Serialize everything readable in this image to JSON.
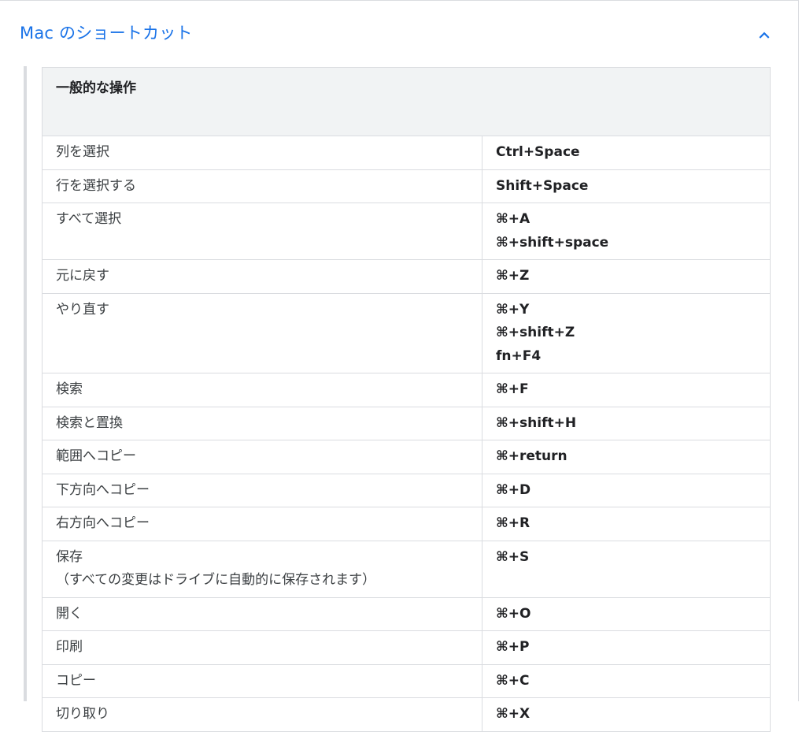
{
  "section": {
    "title": "Mac のショートカット",
    "expanded": true,
    "chevron_icon": "chevron-up-icon",
    "accent_color": "#1a73e8"
  },
  "table": {
    "header": "一般的な操作",
    "rows": [
      {
        "action": [
          "列を選択"
        ],
        "keys": [
          "Ctrl+Space"
        ]
      },
      {
        "action": [
          "行を選択する"
        ],
        "keys": [
          "Shift+Space"
        ]
      },
      {
        "action": [
          "すべて選択"
        ],
        "keys": [
          "⌘+A",
          "⌘+shift+space"
        ]
      },
      {
        "action": [
          "元に戻す"
        ],
        "keys": [
          "⌘+Z"
        ]
      },
      {
        "action": [
          "やり直す"
        ],
        "keys": [
          "⌘+Y",
          "⌘+shift+Z",
          "fn+F4"
        ]
      },
      {
        "action": [
          "検索"
        ],
        "keys": [
          "⌘+F"
        ]
      },
      {
        "action": [
          "検索と置換"
        ],
        "keys": [
          "⌘+shift+H"
        ]
      },
      {
        "action": [
          "範囲へコピー"
        ],
        "keys": [
          "⌘+return"
        ]
      },
      {
        "action": [
          "下方向へコピー"
        ],
        "keys": [
          "⌘+D"
        ]
      },
      {
        "action": [
          "右方向へコピー"
        ],
        "keys": [
          "⌘+R"
        ]
      },
      {
        "action": [
          "保存",
          "（すべての変更はドライブに自動的に保存されます）"
        ],
        "keys": [
          "⌘+S"
        ]
      },
      {
        "action": [
          "開く"
        ],
        "keys": [
          "⌘+O"
        ]
      },
      {
        "action": [
          "印刷"
        ],
        "keys": [
          "⌘+P"
        ]
      },
      {
        "action": [
          "コピー"
        ],
        "keys": [
          "⌘+C"
        ]
      },
      {
        "action": [
          "切り取り"
        ],
        "keys": [
          "⌘+X"
        ]
      }
    ]
  }
}
